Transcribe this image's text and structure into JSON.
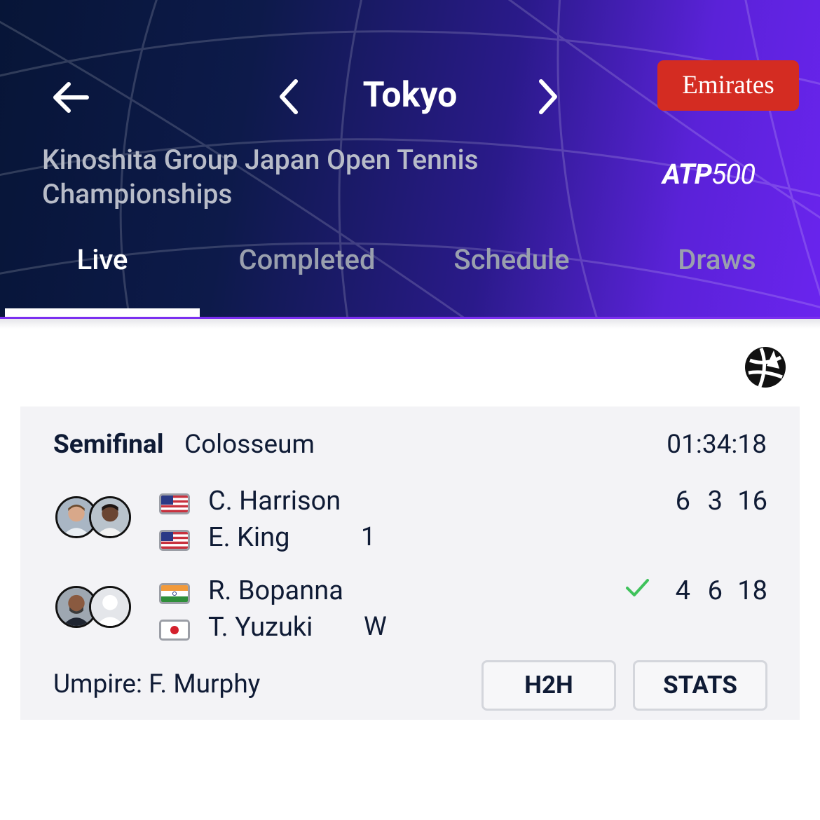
{
  "header": {
    "city": "Tokyo",
    "tournament_name": "Kinoshita Group Japan Open Tennis Championships",
    "sponsor": "Emirates",
    "tier_logo": {
      "prefix": "ATP",
      "number": "500"
    },
    "tabs": [
      {
        "label": "Live",
        "active": true
      },
      {
        "label": "Completed",
        "active": false
      },
      {
        "label": "Schedule",
        "active": false
      },
      {
        "label": "Draws",
        "active": false
      }
    ]
  },
  "match": {
    "round": "Semifinal",
    "court": "Colosseum",
    "duration": "01:34:18",
    "teams": [
      {
        "players": [
          {
            "name": "C. Harrison",
            "flag": "us-flag-icon"
          },
          {
            "name": "E. King",
            "flag": "us-flag-icon"
          }
        ],
        "seed": "1",
        "scores": [
          "6",
          "3",
          "16"
        ],
        "winner": false
      },
      {
        "players": [
          {
            "name": "R. Bopanna",
            "flag": "india-flag-icon"
          },
          {
            "name": "T. Yuzuki",
            "flag": "japan-flag-icon"
          }
        ],
        "seed": "W",
        "scores": [
          "4",
          "6",
          "18"
        ],
        "winner": true
      }
    ],
    "umpire": "Umpire: F. Murphy",
    "buttons": {
      "h2h": "H2H",
      "stats": "STATS"
    }
  },
  "colors": {
    "header_dark": "#071537",
    "header_purple": "#6a24ee",
    "sponsor_red": "#d42c22",
    "winner_green": "#3fc25b",
    "card_bg": "#f3f3f6"
  }
}
